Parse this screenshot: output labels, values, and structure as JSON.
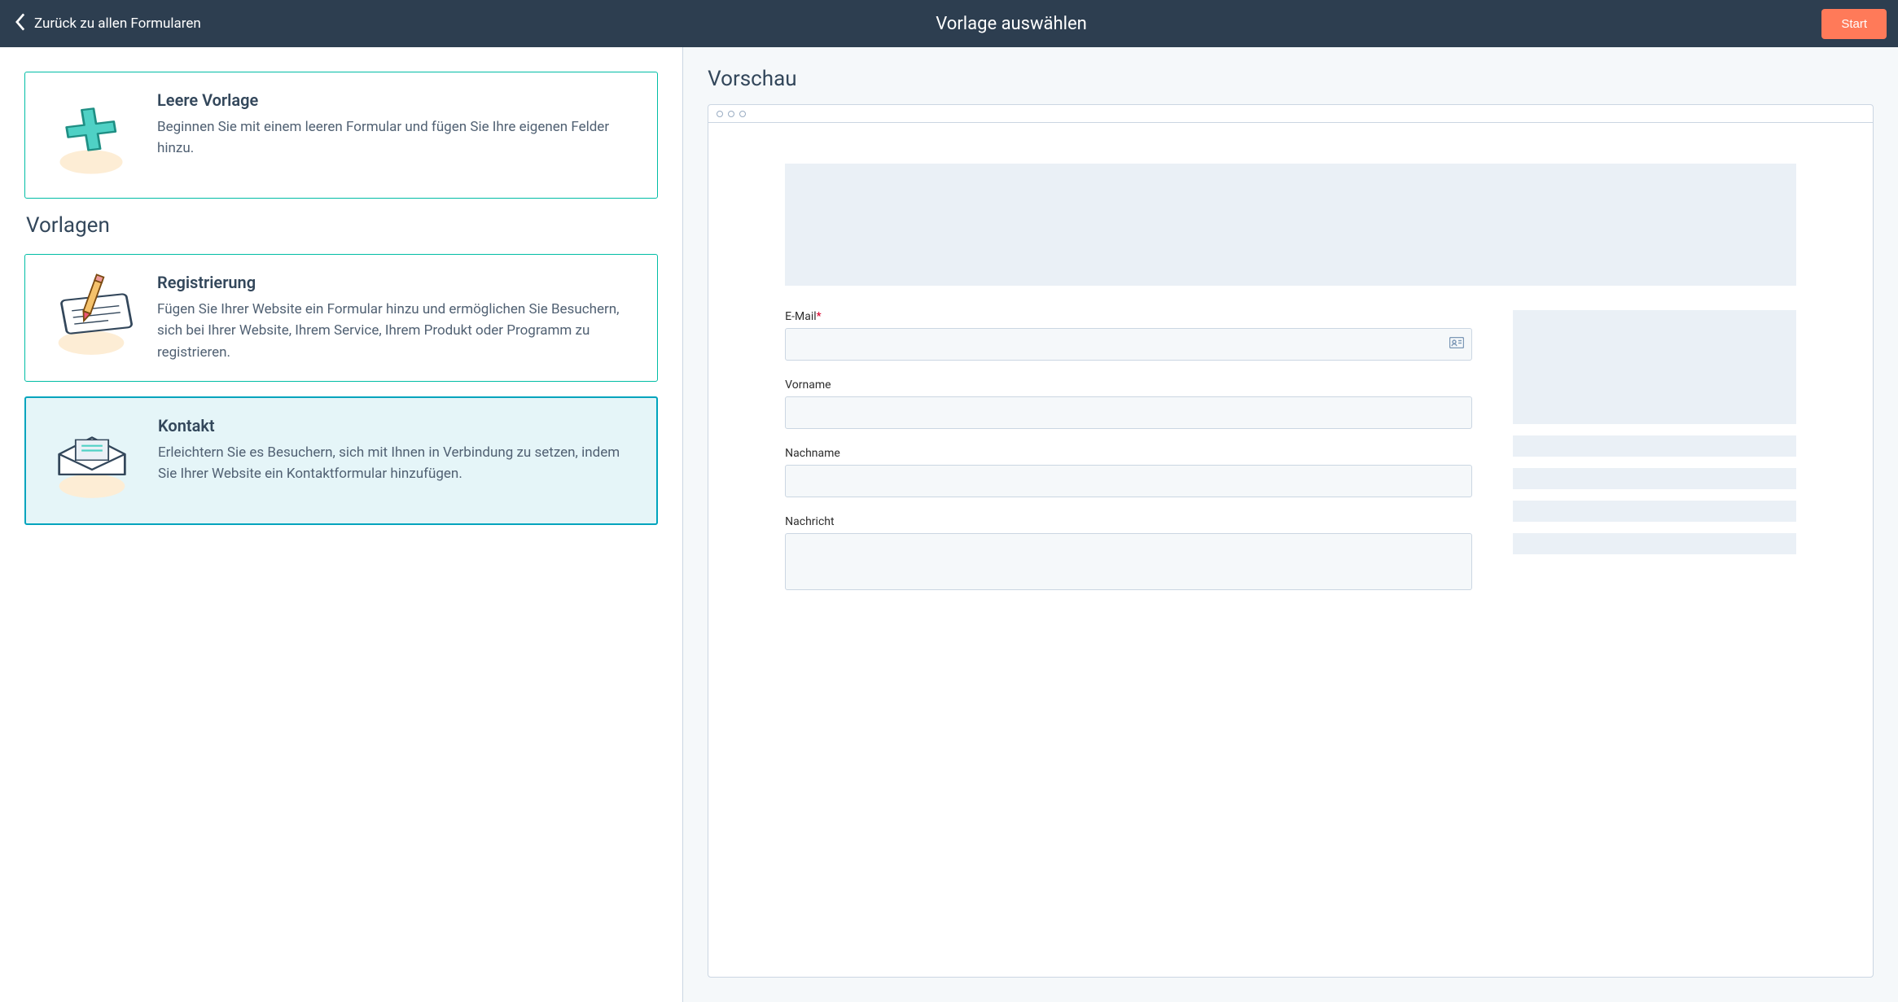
{
  "header": {
    "back_label": "Zurück zu allen Formularen",
    "title": "Vorlage auswählen",
    "start_label": "Start"
  },
  "left": {
    "templates_heading": "Vorlagen",
    "empty": {
      "title": "Leere Vorlage",
      "desc": "Beginnen Sie mit einem leeren Formular und fügen Sie Ihre eigenen Felder hinzu."
    },
    "registration": {
      "title": "Registrierung",
      "desc": "Fügen Sie Ihrer Website ein Formular hinzu und ermöglichen Sie Besuchern, sich bei Ihrer Website, Ihrem Service, Ihrem Produkt oder Programm zu registrieren."
    },
    "contact": {
      "title": "Kontakt",
      "desc": "Erleichtern Sie es Besuchern, sich mit Ihnen in Verbindung zu setzen, indem Sie Ihrer Website ein Kontaktformular hinzufügen."
    }
  },
  "preview": {
    "heading": "Vorschau",
    "fields": {
      "email_label": "E-Mail",
      "firstname_label": "Vorname",
      "lastname_label": "Nachname",
      "message_label": "Nachricht"
    }
  }
}
